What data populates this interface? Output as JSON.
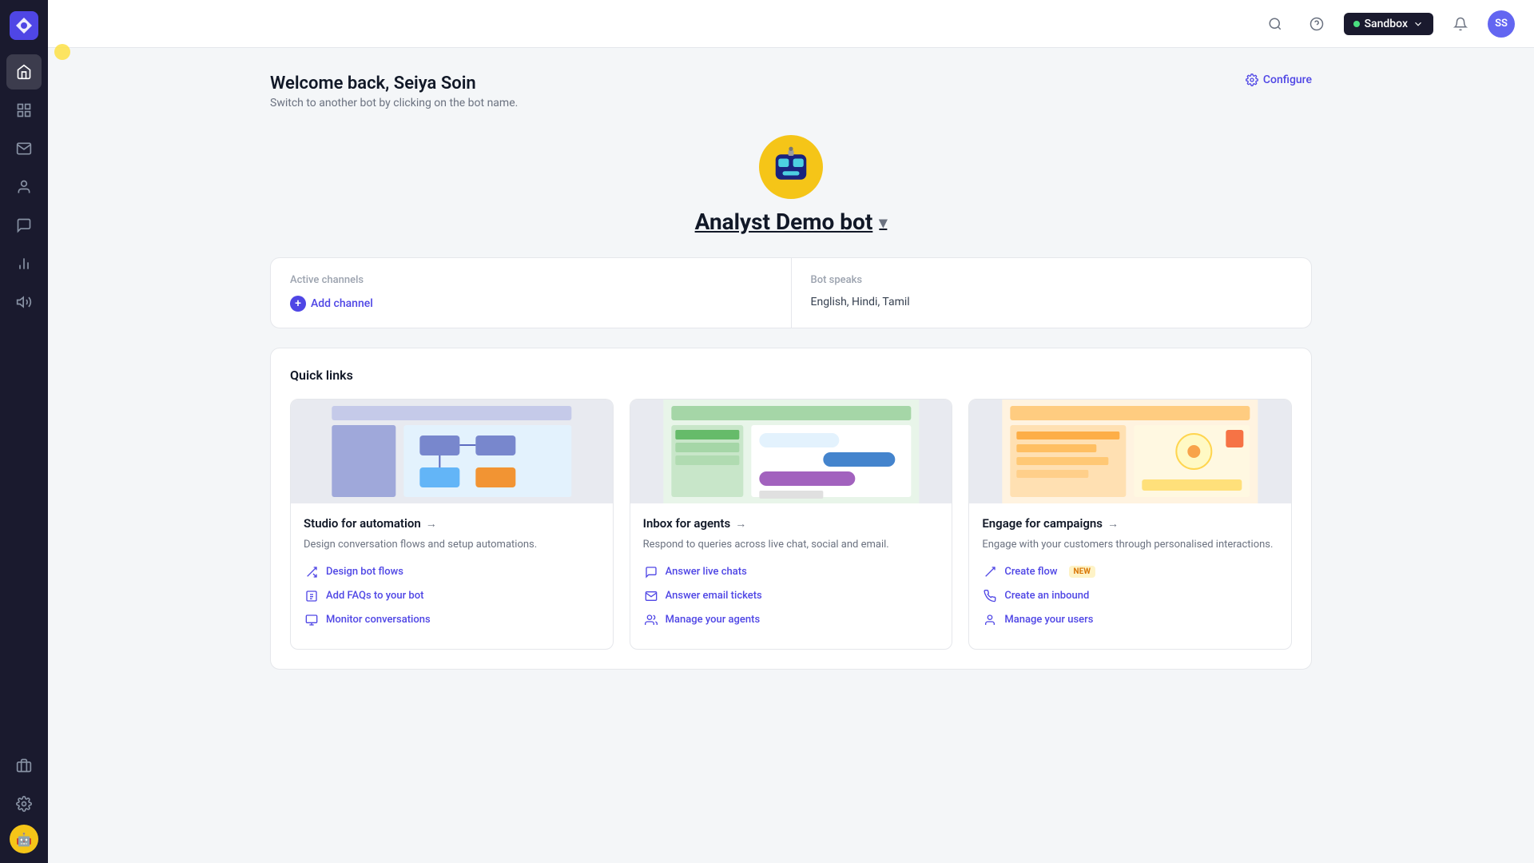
{
  "app": {
    "title": "Analyst Demo bot"
  },
  "topbar": {
    "sandbox_label": "Sandbox",
    "user_initials": "SS",
    "configure_label": "Configure"
  },
  "welcome": {
    "heading": "Welcome back, Seiya Soin",
    "subtext": "Switch to another bot by clicking on the bot name."
  },
  "bot": {
    "name": "Analyst Demo bot",
    "avatar_emoji": "🤖"
  },
  "channels": {
    "active_label": "Active channels",
    "add_channel_label": "Add channel",
    "bot_speaks_label": "Bot speaks",
    "languages": "English, Hindi, Tamil"
  },
  "quick_links": {
    "title": "Quick links",
    "cards": [
      {
        "title": "Studio for automation",
        "description": "Design conversation flows and setup automations.",
        "links": [
          {
            "label": "Design bot flows",
            "icon": "flow-icon"
          },
          {
            "label": "Add FAQs to your bot",
            "icon": "faq-icon"
          },
          {
            "label": "Monitor conversations",
            "icon": "monitor-icon"
          }
        ]
      },
      {
        "title": "Inbox for agents",
        "description": "Respond to queries across live chat, social and email.",
        "links": [
          {
            "label": "Answer live chats",
            "icon": "chat-icon"
          },
          {
            "label": "Answer email tickets",
            "icon": "email-icon"
          },
          {
            "label": "Manage your agents",
            "icon": "agents-icon"
          }
        ]
      },
      {
        "title": "Engage for campaigns",
        "description": "Engage with your customers through personalised interactions.",
        "links": [
          {
            "label": "Create flow",
            "icon": "createflow-icon",
            "badge": "NEW"
          },
          {
            "label": "Create an inbound",
            "icon": "inbound-icon"
          },
          {
            "label": "Manage your users",
            "icon": "users-icon"
          }
        ]
      }
    ]
  },
  "sidebar": {
    "items": [
      {
        "label": "Home",
        "icon": "home-icon"
      },
      {
        "label": "Overview",
        "icon": "overview-icon"
      },
      {
        "label": "Inbox",
        "icon": "inbox-icon"
      },
      {
        "label": "Contacts",
        "icon": "contacts-icon"
      },
      {
        "label": "Conversations",
        "icon": "conversations-icon"
      },
      {
        "label": "Analytics",
        "icon": "analytics-icon"
      },
      {
        "label": "Campaigns",
        "icon": "campaigns-icon"
      }
    ],
    "bottom_items": [
      {
        "label": "Integrations",
        "icon": "integrations-icon"
      },
      {
        "label": "Settings",
        "icon": "settings-icon"
      }
    ]
  }
}
